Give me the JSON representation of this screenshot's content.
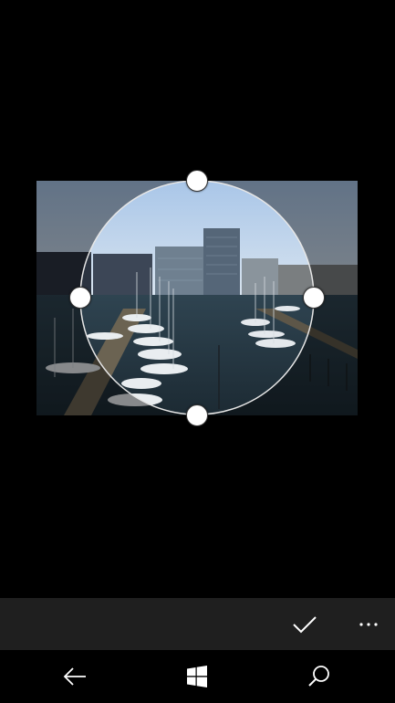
{
  "screen": "photo-crop-circle",
  "photo": {
    "subject": "harbor-marina-with-office-buildings"
  },
  "crop": {
    "shape": "circle",
    "handles": [
      "top",
      "right",
      "bottom",
      "left"
    ]
  },
  "command_bar": {
    "accept_icon": "checkmark-icon",
    "more_icon": "ellipsis-icon"
  },
  "nav_bar": {
    "icons": [
      "back-arrow-icon",
      "windows-start-icon",
      "search-icon"
    ]
  },
  "colors": {
    "background": "#000000",
    "command_bar": "#1f1f1f",
    "handle_fill": "#ffffff",
    "crop_ring": "#e6e6e6"
  }
}
